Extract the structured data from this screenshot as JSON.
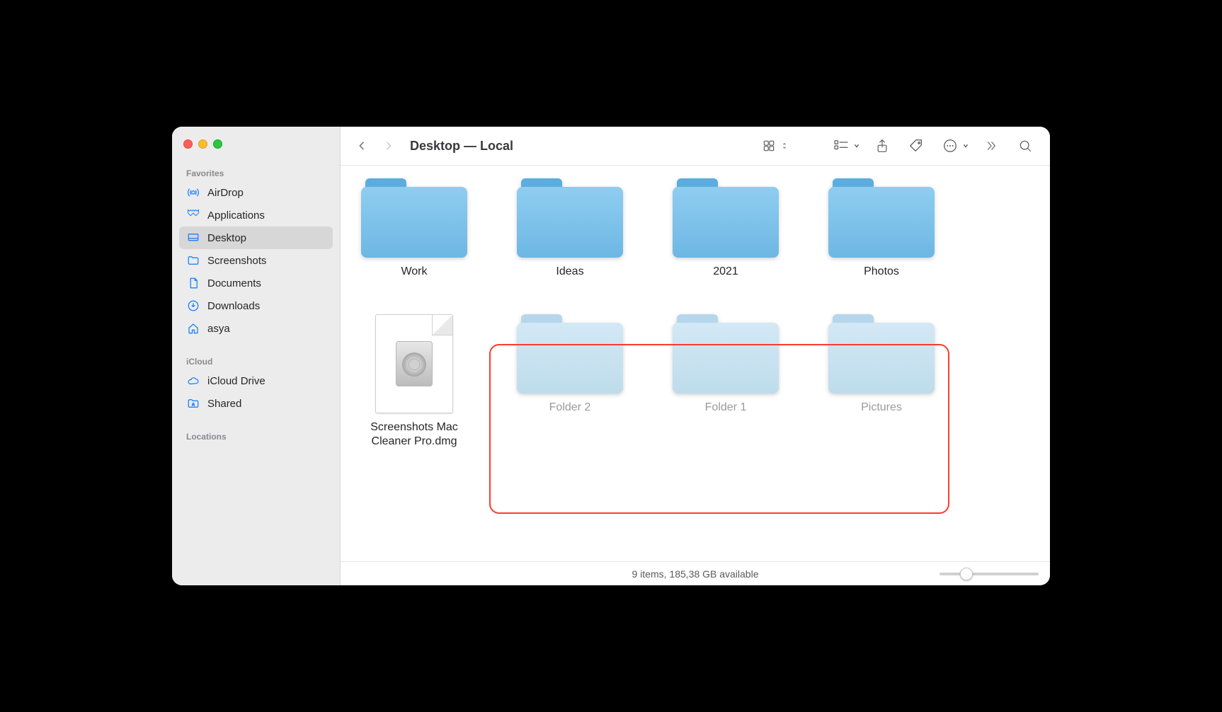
{
  "window": {
    "title": "Desktop — Local"
  },
  "sidebar": {
    "sections": [
      {
        "label": "Favorites",
        "items": [
          {
            "icon": "airdrop",
            "label": "AirDrop",
            "active": false
          },
          {
            "icon": "applications",
            "label": "Applications",
            "active": false
          },
          {
            "icon": "desktop",
            "label": "Desktop",
            "active": true
          },
          {
            "icon": "folder",
            "label": "Screenshots",
            "active": false
          },
          {
            "icon": "document",
            "label": "Documents",
            "active": false
          },
          {
            "icon": "download",
            "label": "Downloads",
            "active": false
          },
          {
            "icon": "home",
            "label": "asya",
            "active": false
          }
        ]
      },
      {
        "label": "iCloud",
        "items": [
          {
            "icon": "cloud",
            "label": "iCloud Drive",
            "active": false
          },
          {
            "icon": "shared",
            "label": "Shared",
            "active": false
          }
        ]
      },
      {
        "label": "Locations",
        "items": []
      }
    ]
  },
  "toolbar": {
    "view_button": "icon-view",
    "group_button": "group",
    "share_button": "share",
    "tags_button": "tags",
    "action_button": "action",
    "overflow_button": "more",
    "search_button": "search"
  },
  "items": [
    {
      "type": "folder",
      "label": "Work",
      "hidden": false
    },
    {
      "type": "folder",
      "label": "Ideas",
      "hidden": false
    },
    {
      "type": "folder",
      "label": "2021",
      "hidden": false
    },
    {
      "type": "folder",
      "label": "Photos",
      "hidden": false
    },
    {
      "type": "file",
      "label": "Screenshots Mac Cleaner Pro.dmg",
      "hidden": false
    },
    {
      "type": "folder",
      "label": "Folder 2",
      "hidden": true
    },
    {
      "type": "folder",
      "label": "Folder 1",
      "hidden": true
    },
    {
      "type": "folder",
      "label": "Pictures",
      "hidden": true
    }
  ],
  "status": {
    "text": "9 items, 185,38 GB available"
  },
  "highlight": {
    "covers_indices": [
      5,
      6,
      7
    ]
  }
}
